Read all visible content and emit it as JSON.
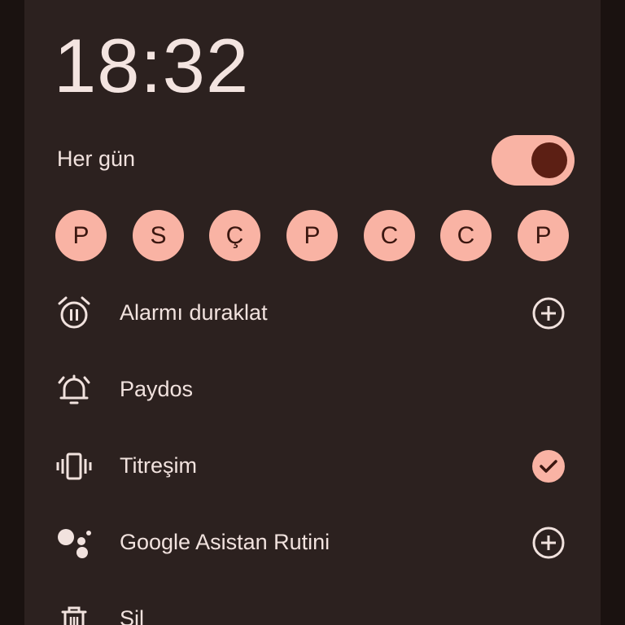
{
  "alarm": {
    "time": "18:32",
    "repeat_label": "Her gün",
    "enabled": true
  },
  "days": [
    "P",
    "S",
    "Ç",
    "P",
    "C",
    "C",
    "P"
  ],
  "options": [
    {
      "label": "Alarmı duraklat",
      "icon": "alarm-snooze-icon",
      "action": "add"
    },
    {
      "label": "Paydos",
      "icon": "alarm-bell-icon",
      "action": "none"
    },
    {
      "label": "Titreşim",
      "icon": "vibration-icon",
      "action": "checked"
    },
    {
      "label": "Google Asistan Rutini",
      "icon": "google-assistant-icon",
      "action": "add"
    },
    {
      "label": "Sil",
      "icon": "trash-icon",
      "action": "none"
    }
  ],
  "colors": {
    "background": "#1a1210",
    "card": "#2c211f",
    "accent": "#f9b3a4",
    "accent_dark": "#5c1f14",
    "text": "#f1e2de"
  }
}
